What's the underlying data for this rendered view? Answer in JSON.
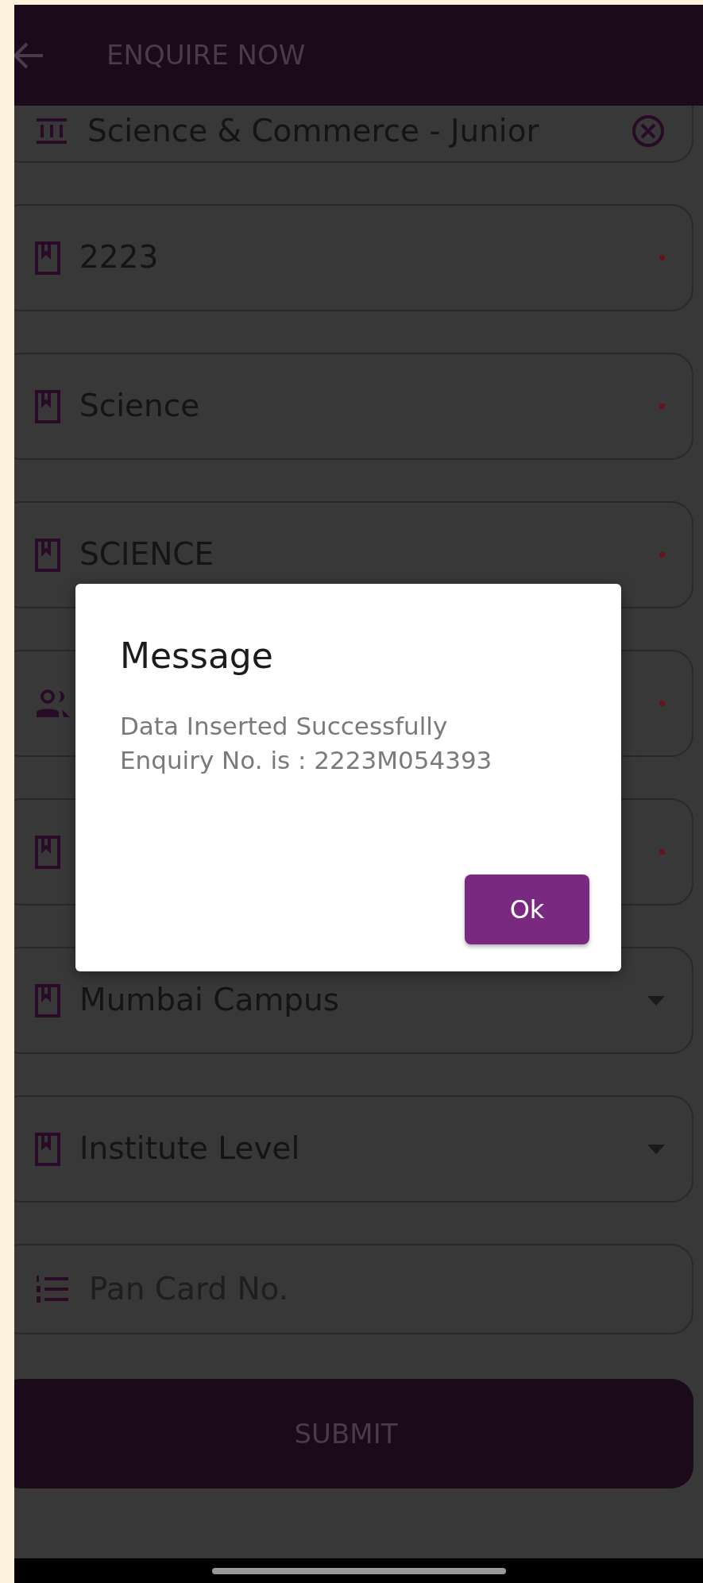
{
  "app_bar": {
    "title": "ENQUIRE NOW"
  },
  "fields": [
    {
      "kind": "clearable",
      "value": "Science & Commerce - Junior",
      "required": false
    },
    {
      "kind": "text",
      "value": "2223",
      "required": true
    },
    {
      "kind": "text",
      "value": "Science",
      "required": true
    },
    {
      "kind": "text",
      "value": "SCIENCE",
      "required": true
    },
    {
      "kind": "person",
      "required": true
    },
    {
      "kind": "text",
      "required": true
    },
    {
      "kind": "dropdown",
      "value": "Mumbai Campus",
      "required": false
    },
    {
      "kind": "dropdown",
      "value": "Institute Level",
      "required": false
    },
    {
      "kind": "entry",
      "placeholder": "Pan Card No.",
      "required": false
    }
  ],
  "submit": {
    "label": "SUBMIT"
  },
  "dialog": {
    "title": "Message",
    "message": "Data Inserted Successfully\nEnquiry No. is : 2223M054393",
    "button": "Ok"
  }
}
